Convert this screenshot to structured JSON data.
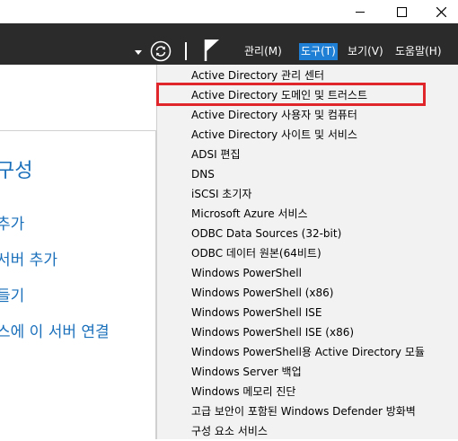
{
  "window": {
    "controls": [
      "minimize-icon",
      "maximize-icon",
      "close-icon"
    ]
  },
  "ribbon": {
    "menus": [
      {
        "label": "관리(M)",
        "active": false
      },
      {
        "label": "도구(T)",
        "active": true
      },
      {
        "label": "보기(V)",
        "active": false
      },
      {
        "label": "도움말(H)",
        "active": false
      }
    ],
    "active_color": "#1e7fd4"
  },
  "left_pane": {
    "title": "구성",
    "links": [
      "추가",
      "서버 추가",
      "들기",
      "스에 이 서버 연결"
    ]
  },
  "tools_menu": {
    "items": [
      "Active Directory 관리 센터",
      "Active Directory 도메인 및 트러스트",
      "Active Directory 사용자 및 컴퓨터",
      "Active Directory 사이트 및 서비스",
      "ADSI 편집",
      "DNS",
      "iSCSI 초기자",
      "Microsoft Azure 서비스",
      "ODBC Data Sources (32-bit)",
      "ODBC 데이터 원본(64비트)",
      "Windows PowerShell",
      "Windows PowerShell (x86)",
      "Windows PowerShell ISE",
      "Windows PowerShell ISE (x86)",
      "Windows PowerShell용 Active Directory 모듈",
      "Windows Server 백업",
      "Windows 메모리 진단",
      "고급 보안이 포함된 Windows Defender 방화벽",
      "구성 요소 서비스"
    ],
    "highlighted_index": 1,
    "highlight_color": "#e1262b"
  }
}
